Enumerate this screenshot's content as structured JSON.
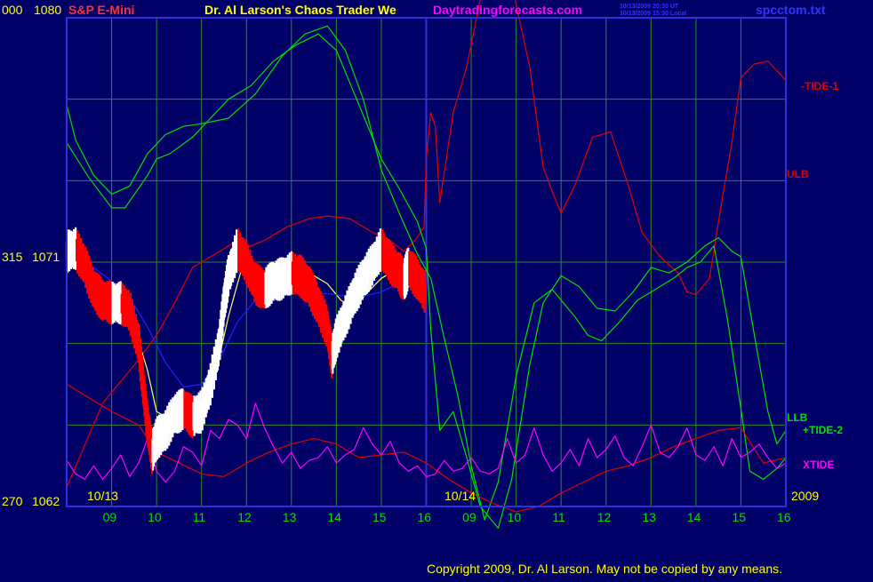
{
  "header": {
    "symbol": "S&P E-Mini",
    "title": "Dr. Al Larson's Chaos Trader We",
    "site": "Daytradingforecasts.com",
    "stamp_ut": "10/13/2009 20:30 UT",
    "stamp_local": "10/13/2009 15:30 Local",
    "file": "spcctom.txt"
  },
  "axis_left": {
    "top_code": "000",
    "top_price": "1080",
    "mid_code": "315",
    "mid_price": "1071",
    "bottom_code": "270",
    "bottom_price": "1062"
  },
  "date_labels": {
    "day1": "10/13",
    "day2": "10/14",
    "year": "2009"
  },
  "series_labels": {
    "tide1": "-TIDE-1",
    "ulb": "ULB",
    "llb": "LLB",
    "tide2": "+TIDE-2",
    "xtide": "XTIDE"
  },
  "copyright": "Copyright 2009, Dr. Al Larson. May not be copied by any means.",
  "colors": {
    "background": "#000066",
    "grid": "#2d8a2d",
    "frame": "#3030dd",
    "tide1": "#e00000",
    "ulb_llb": "#00e000",
    "xtide": "#ff00ff",
    "ma_fast": "#ffff66",
    "ma_slow": "#2020ff",
    "up_bar": "#ffffff",
    "down_bar": "#ff0000",
    "title_red": "#ff3030",
    "title_yellow": "#ffff00",
    "title_magenta": "#ff00ff",
    "file_blue": "#3333ff",
    "copyright": "#ffff00"
  },
  "chart_data": {
    "type": "line",
    "x_unit": "hour (ET)",
    "x_ticks": [
      "09",
      "10",
      "11",
      "12",
      "13",
      "14",
      "15",
      "16",
      "09",
      "10",
      "11",
      "12",
      "13",
      "14",
      "15",
      "16"
    ],
    "xlim": [
      8.0,
      24.0
    ],
    "ylim": [
      1062,
      1080
    ],
    "y_ticks": [
      1062,
      1071,
      1080
    ],
    "grid": true,
    "series": [
      {
        "name": "-TIDE-1",
        "x": [
          8.0,
          8.8,
          9.5,
          10.0,
          10.4,
          10.8,
          11.2,
          11.7,
          12.1,
          12.4,
          12.9,
          13.4,
          13.8,
          14.3,
          14.8,
          15.2,
          15.5,
          15.75,
          15.95,
          16.0,
          16.1,
          16.2,
          16.3,
          16.6,
          16.9,
          17.3,
          17.8,
          18.3,
          18.6,
          18.8,
          19.0,
          19.3,
          19.7,
          20.1,
          20.5,
          20.8,
          21.2,
          21.6,
          21.8,
          22.0,
          22.3,
          22.6,
          22.8,
          23.0,
          23.3,
          23.6,
          24.0
        ],
        "y": [
          1062.7,
          1065.8,
          1067.2,
          1068.3,
          1069.5,
          1070.8,
          1071.2,
          1071.7,
          1071.6,
          1071.8,
          1072.3,
          1072.6,
          1072.7,
          1072.6,
          1072.1,
          1071.8,
          1071.4,
          1071.8,
          1072.3,
          1074.8,
          1076.5,
          1076.0,
          1073.2,
          1076.5,
          1078.2,
          1081.5,
          1082.0,
          1078.2,
          1074.5,
          1073.6,
          1072.8,
          1073.8,
          1075.6,
          1075.8,
          1073.8,
          1072.1,
          1071.2,
          1070.6,
          1069.9,
          1069.8,
          1070.4,
          1073.5,
          1075.4,
          1077.8,
          1078.3,
          1078.4,
          1077.7
        ]
      },
      {
        "name": "ULB",
        "x": [
          8.0,
          8.2,
          8.6,
          9.0,
          9.4,
          9.8,
          10.2,
          10.6,
          11.0,
          11.6,
          12.2,
          12.8,
          13.3,
          13.8,
          14.2,
          14.6,
          15.0,
          15.4,
          15.8,
          16.1,
          16.4,
          16.7,
          17.0,
          17.3,
          17.6,
          18.0,
          18.4,
          18.8,
          19.3,
          19.6,
          19.9,
          20.3,
          20.7,
          21.1,
          21.5,
          21.8,
          22.1,
          22.4,
          22.7,
          23.0,
          23.2,
          23.5,
          23.8,
          24.0
        ],
        "y": [
          1076.8,
          1075.5,
          1074.2,
          1073.5,
          1073.8,
          1075.0,
          1075.7,
          1076.0,
          1076.1,
          1076.3,
          1077.2,
          1078.6,
          1079.4,
          1079.7,
          1078.8,
          1077.0,
          1074.4,
          1072.8,
          1071.3,
          1070.4,
          1068.2,
          1066.1,
          1063.5,
          1061.5,
          1062.9,
          1066.8,
          1069.5,
          1070.0,
          1069.0,
          1068.3,
          1068.1,
          1068.8,
          1069.6,
          1070.0,
          1070.4,
          1070.8,
          1071.0,
          1071.6,
          1068.9,
          1065.6,
          1063.3,
          1063.0,
          1063.4,
          1063.8
        ]
      },
      {
        "name": "LLB",
        "x": [
          8.0,
          8.5,
          9.0,
          9.6,
          10.0,
          10.5,
          11.0,
          11.5,
          12.0,
          12.5,
          13.0,
          13.5,
          14.0,
          14.5,
          15.0,
          15.5,
          16.0,
          16.5,
          17.0,
          17.5,
          18.0,
          18.5,
          19.0,
          19.5,
          20.0,
          20.5,
          21.0,
          21.5,
          22.0,
          22.5,
          23.0,
          23.5,
          24.0
        ],
        "y": [
          1066.5,
          1066.0,
          1065.5,
          1065.0,
          1064.0,
          1063.6,
          1063.2,
          1063.1,
          1063.6,
          1064.0,
          1064.3,
          1064.5,
          1064.3,
          1063.8,
          1063.9,
          1064.0,
          1063.6,
          1063.0,
          1062.5,
          1062.1,
          1061.8,
          1062.0,
          1062.5,
          1062.9,
          1063.3,
          1063.5,
          1063.8,
          1064.2,
          1064.5,
          1064.8,
          1064.9,
          1063.6,
          1063.8
        ]
      },
      {
        "name": "+TIDE-2",
        "x": [
          8.0,
          8.5,
          9.0,
          9.3,
          9.8,
          10.0,
          10.3,
          10.8,
          11.2,
          11.6,
          12.1,
          12.6,
          13.1,
          13.6,
          14.0,
          14.5,
          15.0,
          15.4,
          15.8,
          16.0,
          16.1,
          16.3,
          16.6,
          16.9,
          17.2,
          17.6,
          17.9,
          18.3,
          18.6,
          19.0,
          19.4,
          19.8,
          20.2,
          20.6,
          21.0,
          21.4,
          21.8,
          22.2,
          22.5,
          22.8,
          23.0,
          23.3,
          23.6,
          23.8,
          24.0
        ],
        "y": [
          1075.4,
          1074.1,
          1073.0,
          1073.0,
          1074.2,
          1074.8,
          1075.0,
          1075.6,
          1076.3,
          1077.0,
          1077.5,
          1078.4,
          1079.0,
          1079.4,
          1078.8,
          1076.8,
          1074.8,
          1073.7,
          1072.5,
          1071.5,
          1068.5,
          1064.8,
          1065.5,
          1063.8,
          1062.0,
          1061.2,
          1063.0,
          1067.2,
          1069.5,
          1070.5,
          1070.1,
          1069.3,
          1069.2,
          1069.9,
          1070.8,
          1070.6,
          1071.0,
          1071.6,
          1071.9,
          1071.4,
          1071.2,
          1068.3,
          1065.5,
          1064.3,
          1064.8
        ]
      },
      {
        "name": "XTIDE",
        "x": [
          8.0,
          8.2,
          8.4,
          8.6,
          8.8,
          9.0,
          9.2,
          9.4,
          9.6,
          9.8,
          10.0,
          10.2,
          10.4,
          10.6,
          10.8,
          11.0,
          11.2,
          11.4,
          11.6,
          11.8,
          12.0,
          12.2,
          12.4,
          12.6,
          12.8,
          13.0,
          13.2,
          13.4,
          13.6,
          13.8,
          14.0,
          14.2,
          14.4,
          14.6,
          14.8,
          15.0,
          15.2,
          15.4,
          15.6,
          15.8,
          16.0,
          16.2,
          16.4,
          16.6,
          16.8,
          17.0,
          17.2,
          17.4,
          17.6,
          17.8,
          18.0,
          18.2,
          18.4,
          18.6,
          18.8,
          19.0,
          19.2,
          19.4,
          19.6,
          19.8,
          20.0,
          20.2,
          20.4,
          20.6,
          20.8,
          21.0,
          21.2,
          21.4,
          21.6,
          21.8,
          22.0,
          22.2,
          22.4,
          22.6,
          22.8,
          23.0,
          23.2,
          23.4,
          23.6,
          23.8,
          24.0
        ],
        "y": [
          1063.7,
          1063.2,
          1063.0,
          1063.5,
          1063.0,
          1063.4,
          1063.9,
          1063.1,
          1063.6,
          1064.5,
          1063.3,
          1062.9,
          1063.3,
          1064.2,
          1064.0,
          1063.5,
          1064.8,
          1064.5,
          1065.2,
          1065.0,
          1064.5,
          1065.8,
          1064.9,
          1064.2,
          1063.6,
          1064.0,
          1063.4,
          1063.7,
          1063.8,
          1064.2,
          1063.6,
          1063.9,
          1064.1,
          1064.9,
          1064.3,
          1063.9,
          1064.4,
          1063.6,
          1063.3,
          1063.5,
          1063.1,
          1063.2,
          1063.7,
          1063.3,
          1063.4,
          1063.8,
          1063.3,
          1063.2,
          1063.4,
          1064.5,
          1063.6,
          1063.9,
          1064.9,
          1063.9,
          1063.3,
          1063.6,
          1064.1,
          1063.5,
          1064.5,
          1063.8,
          1064.1,
          1064.6,
          1063.8,
          1063.5,
          1064.2,
          1065.0,
          1064.0,
          1063.8,
          1064.2,
          1064.9,
          1063.9,
          1063.7,
          1064.2,
          1063.5,
          1064.5,
          1063.8,
          1064.0,
          1064.3,
          1063.8,
          1063.4,
          1063.6
        ]
      },
      {
        "name": "fast average",
        "x": [
          8.0,
          8.3,
          8.6,
          9.0,
          9.4,
          9.8,
          10.0,
          10.3,
          10.6,
          11.0,
          11.3,
          11.6,
          11.9,
          12.1,
          12.5,
          13.0,
          13.4,
          13.8,
          14.1,
          14.4,
          14.7,
          15.0,
          15.3,
          15.5,
          15.8,
          16.0
        ],
        "y": [
          1071.0,
          1071.2,
          1070.0,
          1069.8,
          1069.2,
          1067.0,
          1065.5,
          1065.2,
          1065.4,
          1065.5,
          1066.8,
          1069.0,
          1070.8,
          1071.0,
          1070.3,
          1070.2,
          1070.6,
          1070.2,
          1069.6,
          1069.3,
          1069.9,
          1070.4,
          1070.7,
          1070.8,
          1070.3,
          1070.1
        ]
      },
      {
        "name": "slow average",
        "x": [
          8.0,
          8.6,
          9.0,
          9.4,
          9.8,
          10.2,
          10.6,
          11.0,
          11.4,
          11.8,
          12.2,
          12.8,
          13.4,
          14.0,
          14.5,
          15.0,
          15.5,
          16.0
        ],
        "y": [
          1071.0,
          1070.8,
          1070.3,
          1069.7,
          1068.6,
          1067.3,
          1066.4,
          1066.5,
          1067.4,
          1068.8,
          1069.6,
          1069.8,
          1069.9,
          1069.8,
          1069.7,
          1069.9,
          1070.3,
          1070.5
        ]
      },
      {
        "name": "price bars",
        "x": [
          8.0,
          8.2,
          8.4,
          8.6,
          8.8,
          9.0,
          9.2,
          9.4,
          9.6,
          9.7,
          9.8,
          9.9,
          10.0,
          10.2,
          10.4,
          10.6,
          10.8,
          11.0,
          11.2,
          11.4,
          11.5,
          11.6,
          11.8,
          12.0,
          12.2,
          12.4,
          12.6,
          12.8,
          13.0,
          13.2,
          13.4,
          13.6,
          13.8,
          13.9,
          14.0,
          14.2,
          14.4,
          14.6,
          14.8,
          15.0,
          15.2,
          15.4,
          15.5,
          15.6,
          15.8,
          16.0
        ],
        "y": [
          1071.4,
          1071.5,
          1070.9,
          1070.0,
          1069.6,
          1069.5,
          1069.5,
          1069.2,
          1068.0,
          1066.5,
          1065.0,
          1064.0,
          1064.5,
          1064.8,
          1065.4,
          1065.6,
          1065.3,
          1065.5,
          1066.5,
          1068.0,
          1069.5,
          1070.5,
          1071.5,
          1071.0,
          1070.2,
          1070.0,
          1070.3,
          1070.4,
          1070.6,
          1070.5,
          1070.1,
          1069.4,
          1068.6,
          1067.5,
          1068.2,
          1069.0,
          1069.8,
          1070.4,
          1070.9,
          1071.5,
          1071.0,
          1070.6,
          1070.3,
          1070.8,
          1070.4,
          1069.8
        ]
      }
    ]
  }
}
